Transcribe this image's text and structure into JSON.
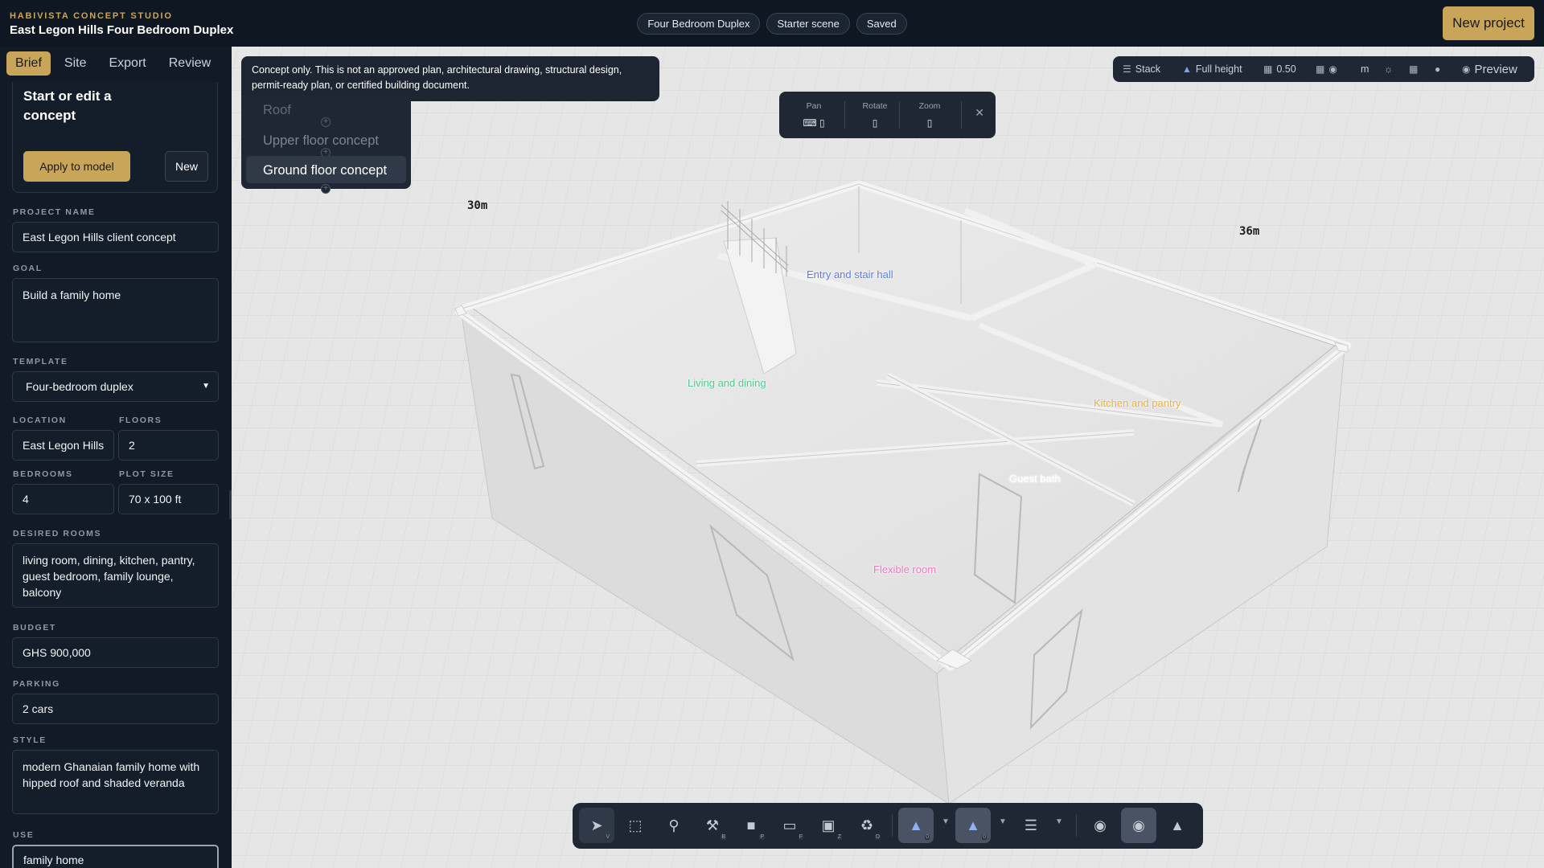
{
  "app": {
    "studio": "HABIVISTA CONCEPT STUDIO",
    "project_title": "East Legon Hills Four Bedroom Duplex",
    "new_project_label": "New project"
  },
  "header_pills": [
    "Four Bedroom Duplex",
    "Starter scene",
    "Saved"
  ],
  "sidebar": {
    "tabs": [
      "Brief",
      "Site",
      "Export",
      "Review"
    ],
    "active_tab": "Brief",
    "start_card": {
      "title": "Start or edit a concept",
      "apply_label": "Apply to model",
      "new_label": "New"
    },
    "fields": {
      "project_name": {
        "label": "PROJECT NAME",
        "value": "East Legon Hills client concept"
      },
      "goal": {
        "label": "GOAL",
        "value": "Build a family home"
      },
      "template": {
        "label": "TEMPLATE",
        "value": "Four-bedroom duplex"
      },
      "location": {
        "label": "LOCATION",
        "value": "East Legon Hills"
      },
      "floors": {
        "label": "FLOORS",
        "value": "2"
      },
      "bedrooms": {
        "label": "BEDROOMS",
        "value": "4"
      },
      "plot_size": {
        "label": "PLOT SIZE",
        "value": "70 x 100 ft"
      },
      "desired_rooms": {
        "label": "DESIRED ROOMS",
        "value": "living room, dining, kitchen, pantry, guest bedroom, family lounge, balcony"
      },
      "budget": {
        "label": "BUDGET",
        "value": "GHS 900,000"
      },
      "parking": {
        "label": "PARKING",
        "value": "2 cars"
      },
      "style": {
        "label": "STYLE",
        "value": "modern Ghanaian family home with hipped roof and shaded veranda"
      },
      "use": {
        "label": "USE",
        "value": "family home"
      }
    }
  },
  "viewport": {
    "disclaimer": "Concept only. This is not an approved plan, architectural drawing, structural design, permit-ready plan, or certified building document.",
    "levels": [
      "Roof",
      "Upper floor concept",
      "Ground floor concept"
    ],
    "active_level": "Ground floor concept",
    "camera_controls": [
      "Pan",
      "Rotate",
      "Zoom"
    ],
    "view_toolbar": {
      "stack_label": "Stack",
      "height_label": "Full height",
      "opacity_value": "0.50",
      "unit_label": "m",
      "preview_label": "Preview"
    },
    "dimensions": {
      "left": "30m",
      "right": "36m"
    },
    "rooms": [
      {
        "name": "Entry and stair hall",
        "color": "#5b7fe0"
      },
      {
        "name": "Living and dining",
        "color": "#52c98a"
      },
      {
        "name": "Kitchen and pantry",
        "color": "#e6b23c"
      },
      {
        "name": "Guest bath",
        "color": "#ffffff"
      },
      {
        "name": "Flexible room",
        "color": "#e879c0"
      }
    ]
  },
  "bottom_toolbar": {
    "tools": [
      {
        "icon": "select-pointer-icon",
        "key": "V"
      },
      {
        "icon": "box-select-icon",
        "key": ""
      },
      {
        "icon": "pin-icon",
        "key": ""
      },
      {
        "icon": "build-tools-icon",
        "key": "B"
      },
      {
        "icon": "paint-icon",
        "key": "P"
      },
      {
        "icon": "floor-slab-icon",
        "key": "F"
      },
      {
        "icon": "zone-cube-icon",
        "key": "Z"
      },
      {
        "icon": "delete-icon",
        "key": "D"
      }
    ],
    "layer_counts": [
      "0",
      "0"
    ]
  },
  "colors": {
    "accent": "#c9a55a",
    "chrome": "#0f1722",
    "panel": "#1f2734",
    "viewport_bg": "#e6e6e6"
  }
}
